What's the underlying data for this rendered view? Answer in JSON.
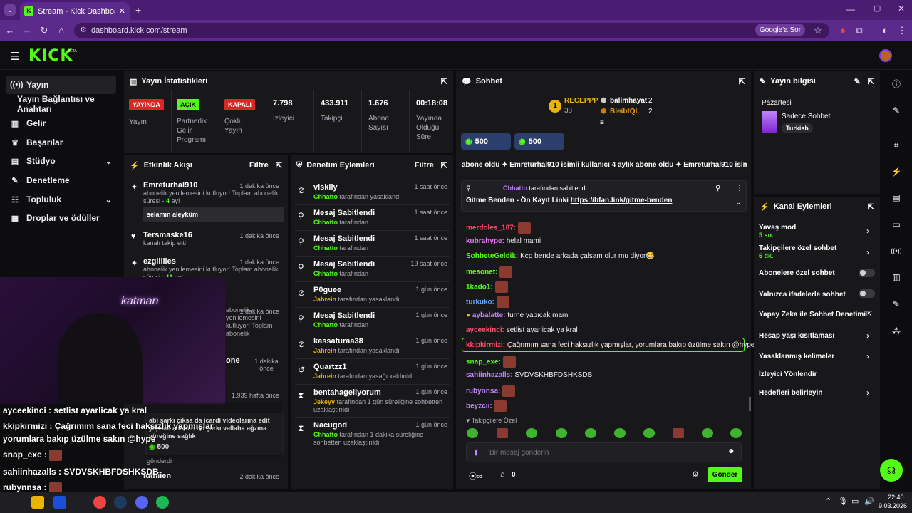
{
  "browser": {
    "tab_title": "Stream - Kick Dashboard",
    "url": "dashboard.kick.com/stream",
    "ask_google": "Google'a Sor"
  },
  "app": {
    "logo": "KICK",
    "beta": "BETA"
  },
  "nav": {
    "items": [
      {
        "label": "Yayın",
        "icon": "broadcast-icon"
      },
      {
        "label": "Yayın Bağlantısı ve Anahtarı",
        "icon": ""
      },
      {
        "label": "Gelir",
        "icon": "chart-icon"
      },
      {
        "label": "Başarılar",
        "icon": "trophy-icon"
      },
      {
        "label": "Stüdyo",
        "icon": "studio-icon"
      },
      {
        "label": "Denetleme",
        "icon": "wrench-icon"
      },
      {
        "label": "Topluluk",
        "icon": "community-icon"
      },
      {
        "label": "Droplar ve ödüller",
        "icon": "gift-icon"
      }
    ]
  },
  "stats": {
    "title": "Yayın İstatistikleri",
    "status_badge": "YAYINDA",
    "status_label": "Yayın",
    "partner_badge": "AÇIK",
    "partner_label": "Partnerlik Gelir Programı",
    "multi_badge": "KAPALI",
    "multi_label": "Çoklu Yayın",
    "viewers_value": "7.798",
    "viewers_label": "İzleyici",
    "followers_value": "433.911",
    "followers_label": "Takipçi",
    "subs_value": "1.676",
    "subs_label": "Abone Sayısı",
    "uptime_value": "00:18:08",
    "uptime_label": "Yayında Olduğu Süre"
  },
  "activity": {
    "title": "Etkinlik Akışı",
    "filter": "Filtre",
    "items": [
      {
        "user": "Emreturhal910",
        "time": "1 dakika önce",
        "desc_a": "abonelik yenilemesini kutluyor! Toplam abonelik süresi - ",
        "desc_b": "4",
        "desc_c": " ay!",
        "box": "selamın aleyküm"
      },
      {
        "user": "Tersmaske16",
        "time": "1 dakika önce",
        "desc": "kanalı takip etti"
      },
      {
        "user": "ezgililies",
        "time": "1 dakika önce",
        "desc_a": "abonelik yenilemesini kutluyor! Toplam abonelik süresi - ",
        "desc_b": "11",
        "desc_c": " ay!"
      },
      {
        "user": "",
        "time": "1 dakika önce",
        "desc": "abonelik yenilemesini kutluyor! Toplam abonelik"
      },
      {
        "user": "one",
        "time": "1 dakika önce"
      },
      {
        "user": "",
        "time": "1.939 hafta önce"
      },
      {
        "user": "luthiien",
        "time": "2 dakika önce"
      }
    ],
    "gift_text": "abi şarkı çıksa da icardi videolarına edit yapsak adamın bu şarkı vallaha ağzına yüreğine sağlık",
    "gift_amount": "500",
    "gift_sent": "gönderdi"
  },
  "moderation": {
    "title": "Denetim Eylemleri",
    "filter": "Filtre",
    "items": [
      {
        "title": "viskiiy",
        "by": "Chhatto",
        "desc": "tarafından yasaklandı",
        "time": "1 saat önce",
        "icon": "ban-icon"
      },
      {
        "title": "Mesaj Sabitlendi",
        "by": "Chhatto",
        "desc": "tarafından",
        "time": "1 saat önce",
        "icon": "pin-icon"
      },
      {
        "title": "Mesaj Sabitlendi",
        "by": "Chhatto",
        "desc": "tarafından",
        "time": "1 saat önce",
        "icon": "pin-icon"
      },
      {
        "title": "Mesaj Sabitlendi",
        "by": "Chhatto",
        "desc": "tarafından",
        "time": "19 saat önce",
        "icon": "pin-icon"
      },
      {
        "title": "P0guee",
        "by": "Jahrein",
        "desc": "tarafından yasaklandı",
        "time": "1 gün önce",
        "icon": "ban-icon"
      },
      {
        "title": "Mesaj Sabitlendi",
        "by": "Chhatto",
        "desc": "tarafından",
        "time": "1 gün önce",
        "icon": "pin-icon"
      },
      {
        "title": "kassaturaa38",
        "by": "Jahrein",
        "desc": "tarafından yasaklandı",
        "time": "1 gün önce",
        "icon": "ban-icon"
      },
      {
        "title": "Quartzz1",
        "by": "Jahrein",
        "desc": "tarafından yasağı kaldırıldı",
        "time": "1 gün önce",
        "icon": "undo-icon"
      },
      {
        "title": "bentahageliyorum",
        "by": "Jekeyy",
        "desc": "tarafından 1 gün süreliğine sohbetten uzaklaştırıldı",
        "time": "1 gün önce",
        "icon": "timeout-icon"
      },
      {
        "title": "Nacugod",
        "by": "Chhatto",
        "desc": "tarafından 1 dakika süreliğine sohbetten uzaklaştırıldı",
        "time": "1 gün önce",
        "icon": "timeout-icon"
      }
    ]
  },
  "chat": {
    "title": "Sohbet",
    "leader1_name": "RECEPPP",
    "leader1_val": "38",
    "leader2_name": "balimhayat",
    "leader2_val": "2",
    "leader3_name": "BleibtQL",
    "leader3_val": "2",
    "gift1": "500",
    "gift2": "500",
    "ticker": "abone oldu  ✦ Emreturhal910 isimli kullanıcı 4 aylık abone oldu  ✦ Emreturhal910 isim",
    "pinned_by": "Chhatto",
    "pinned_by_text": "tarafından sabitlendi",
    "pinned_msg": "Gitme Benden - Ön Kayıt Linki ",
    "pinned_link": "https://bfan.link/gitme-benden",
    "messages": [
      {
        "user": "merdoles_187:",
        "text": "",
        "color": "#ff4d6d"
      },
      {
        "user": "kubrahype:",
        "text": "helal mami",
        "color": "#e879f9"
      },
      {
        "user": "SohbeteGeldik:",
        "text": "Kcp bende arkada çalsam olur mu diyor😂",
        "color": "#53fc18"
      },
      {
        "user": "mesonet:",
        "text": "",
        "color": "#53fc18"
      },
      {
        "user": "1kado1:",
        "text": "",
        "color": "#53fc18"
      },
      {
        "user": "turkuko:",
        "text": "",
        "color": "#60a5fa"
      },
      {
        "user": "aybalatte:",
        "text": "turne yapıcak mami",
        "color": "#c084fc"
      },
      {
        "user": "ayceekinci:",
        "text": "setlist ayarlicak ya kral",
        "color": "#ff4d6d"
      },
      {
        "user": "kkipkirmizi:",
        "text": "Çağrımım sana feci haksızlık yapmışlar, yorumlara bakıp üzülme sakın @hype",
        "color": "#ff4d6d"
      },
      {
        "user": "snap_exe:",
        "text": "",
        "color": "#53fc18"
      },
      {
        "user": "sahiinhazalls:",
        "text": "SVDVSKHBFDSHKSDB",
        "color": "#c084fc"
      },
      {
        "user": "rubynnsa:",
        "text": "",
        "color": "#c084fc"
      },
      {
        "user": "beyzcii:",
        "text": "",
        "color": "#c084fc"
      }
    ],
    "followers_only": "Takipçilere Özel",
    "input_placeholder": "Bir mesaj gönderin",
    "points": "0",
    "send": "Gönder"
  },
  "stream_info": {
    "title": "Yayın bilgisi",
    "day": "Pazartesi",
    "stream_title": "Sadece Sohbet",
    "language": "Turkish"
  },
  "channel_actions": {
    "title": "Kanal Eylemleri",
    "slow_mode": "Yavaş mod",
    "slow_mode_val": "5 sn.",
    "followers_chat": "Takipçilere özel sohbet",
    "followers_chat_val": "6 dk.",
    "subs_chat": "Abonelere özel sohbet",
    "emote_chat": "Yalnızca ifadelerle sohbet",
    "ai_mod": "Yapay Zeka ile Sohbet Denetimi",
    "age_restrict": "Hesap yaşı kısıtlaması",
    "banned_words": "Yasaklanmış kelimeler",
    "redirect": "İzleyici Yönlendir",
    "goals": "Hedefleri belirleyin"
  },
  "overlay": {
    "line1": "ayceekinci : setlist ayarlicak ya kral",
    "line2": "kkipkirmizi : Çağrımım sana feci haksızlık yapmışlar,",
    "line3": "yorumlara bakıp üzülme sakın @hype",
    "line4": "snap_exe :",
    "line5": "sahiinhazalls : SVDVSKHBFDSHKSDB",
    "line6": "rubynnsa :"
  },
  "taskbar": {
    "time": "22:40",
    "date": "9.03.2026"
  }
}
